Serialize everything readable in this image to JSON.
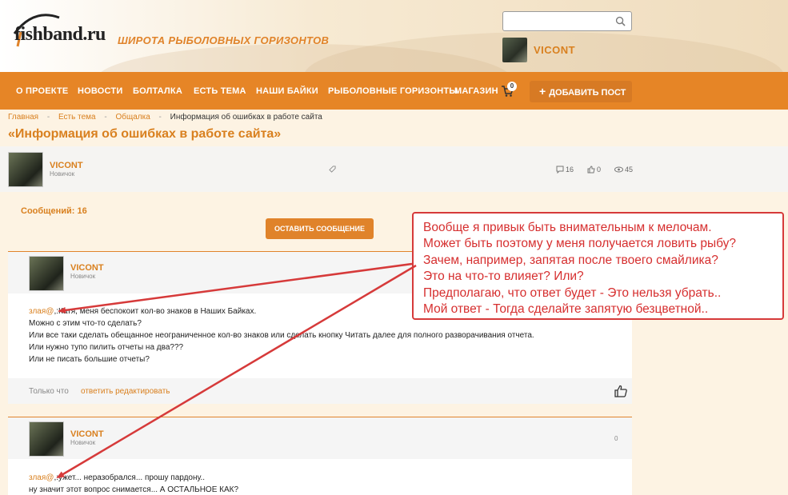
{
  "header": {
    "logo_text": "fishband.ru",
    "tagline": "ШИРОТА РЫБОЛОВНЫХ ГОРИЗОНТОВ",
    "search_placeholder": "",
    "username": "VICONT"
  },
  "nav": {
    "items": [
      "О ПРОЕКТЕ",
      "НОВОСТИ",
      "БОЛТАЛКА",
      "ЕСТЬ ТЕМА",
      "НАШИ БАЙКИ",
      "РЫБОЛОВНЫЕ ГОРИЗОНТЫ",
      "МАГАЗИН"
    ],
    "cart_count": "0",
    "add_post": "ДОБАВИТЬ ПОСТ"
  },
  "breadcrumb": {
    "items": [
      "Главная",
      "Есть тема",
      "Общалка"
    ],
    "current": "Информация об ошибках в работе сайта",
    "separator": "-"
  },
  "page_title": "«Информация об ошибках в работе сайта»",
  "topic": {
    "author": "VICONT",
    "role": "Новичок",
    "comments": "16",
    "likes": "0",
    "views": "45"
  },
  "messages_count": "Сообщений: 16",
  "leave_message": "ОСТАВИТЬ СООБЩЕНИЕ",
  "posts": [
    {
      "author": "VICONT",
      "role": "Новичок",
      "count": "0",
      "mention": "злая@",
      "lines": [
        ",:Катя, меня беспокоит кол-во знаков в Наших Байках.",
        "Можно с этим что-то сделать?",
        "Или все таки сделать обещанное неограниченное кол-во знаков или сделать кнопку Читать далее для полного разворачивания отчета.",
        "Или нужно тупо пилить отчеты на два???",
        "Или не писать большие отчеты?"
      ],
      "time": "Только что",
      "reply": "ответить",
      "edit": "редактировать"
    },
    {
      "author": "VICONT",
      "role": "Новичок",
      "count": "0",
      "mention": "злая@",
      "lines": [
        ",:ужет... неразобрался... прошу пардону..",
        "ну значит этот вопрос снимается... А ОСТАЛЬНОЕ КАК?"
      ]
    }
  ],
  "annotation": {
    "color": "#d62f2f",
    "lines": [
      "Вообще я привык быть внимательным к мелочам.",
      "Может быть поэтому у меня получается ловить рыбу?",
      "Зачем, например, запятая после твоего смайлика?",
      "Это на что-то влияет? Или?",
      "Предполагаю, что ответ будет - Это нельзя убрать..",
      "Мой ответ - Тогда сделайте запятую безцветной.."
    ]
  },
  "colors": {
    "accent": "#e68526",
    "link": "#d9801f",
    "annotation": "#d62f2f"
  }
}
